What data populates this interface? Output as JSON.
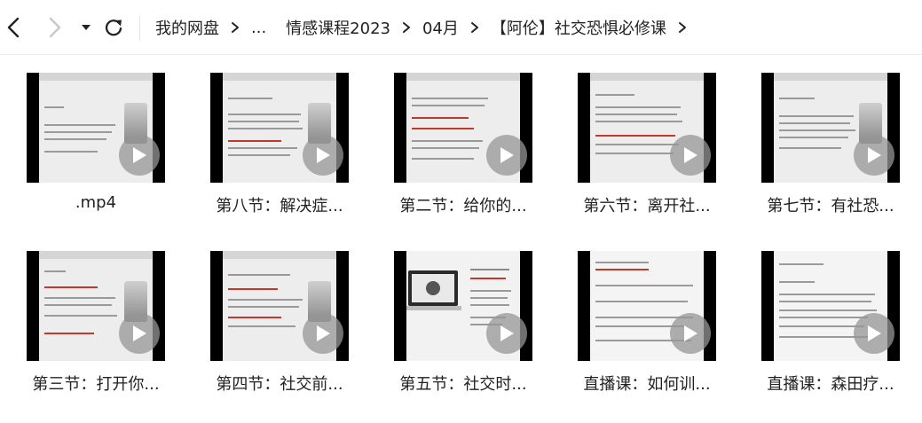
{
  "toolbar": {
    "back_icon": "chevron-left-icon",
    "forward_icon": "chevron-right-icon",
    "dropdown_icon": "caret-down-icon",
    "refresh_icon": "refresh-icon"
  },
  "breadcrumb": {
    "items": [
      {
        "label": "我的网盘"
      },
      {
        "label": "..."
      },
      {
        "label": "情感课程2023"
      },
      {
        "label": "04月"
      },
      {
        "label": "【阿伦】社交恐惧必修课"
      }
    ],
    "separator": ">"
  },
  "files": [
    {
      "label": ".mp4",
      "icon": "play-icon"
    },
    {
      "label": "第八节：解决症...",
      "icon": "play-icon"
    },
    {
      "label": "第二节：给你的...",
      "icon": "play-icon"
    },
    {
      "label": "第六节：离开社...",
      "icon": "play-icon"
    },
    {
      "label": "第七节：有社恐...",
      "icon": "play-icon"
    },
    {
      "label": "第三节：打开你...",
      "icon": "play-icon"
    },
    {
      "label": "第四节：社交前...",
      "icon": "play-icon"
    },
    {
      "label": "第五节：社交时...",
      "icon": "play-icon"
    },
    {
      "label": "直播课：如何训...",
      "icon": "play-icon"
    },
    {
      "label": "直播课：森田疗...",
      "icon": "play-icon"
    }
  ],
  "colors": {
    "text": "#222222",
    "thumb_background": "#000000",
    "slide_background": "#ededed",
    "accent_red": "#c0392b"
  }
}
